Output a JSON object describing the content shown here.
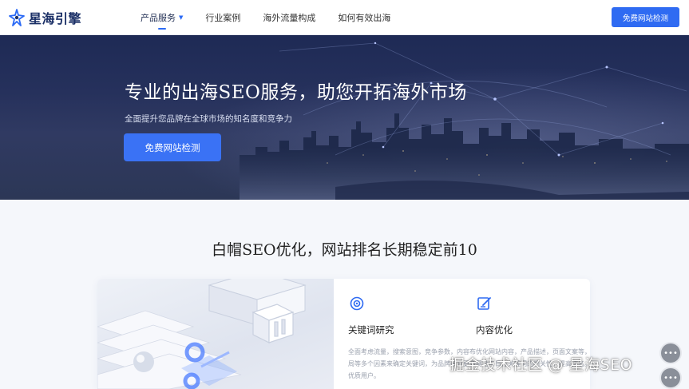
{
  "brand": {
    "name": "星海引擎"
  },
  "nav": {
    "items": [
      {
        "label": "产品服务",
        "has_dropdown": true,
        "active": true
      },
      {
        "label": "行业案例"
      },
      {
        "label": "海外流量构成"
      },
      {
        "label": "如何有效出海"
      }
    ],
    "cta_label": "免费网站检测"
  },
  "hero": {
    "title": "专业的出海SEO服务，助您开拓海外市场",
    "subtitle": "全面提升您品牌在全球市场的知名度和竞争力",
    "button_label": "免费网站检测"
  },
  "section": {
    "title": "白帽SEO优化，网站排名长期稳定前10",
    "features": [
      {
        "icon": "target-icon",
        "title": "关键词研究",
        "desc": "全面考虑流量，搜索意图，竞争参数，内容布局等多个因素来确定关键词，为品牌带来更多优质用户。"
      },
      {
        "icon": "edit-icon",
        "title": "内容优化",
        "desc": "优化网站内容，产品描述，页面文案等，提升网站与目标关键词的相关性，提高排名。"
      }
    ]
  },
  "watermark": "掘金技术社区 @ 星海SEO",
  "colors": {
    "primary": "#2f6bf2",
    "hero_bg": "#26315c",
    "page_bg": "#f5f7fb"
  }
}
